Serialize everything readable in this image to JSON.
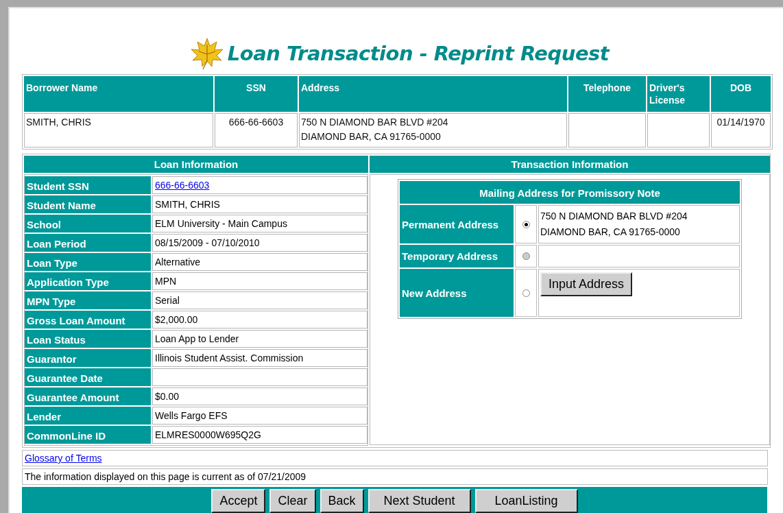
{
  "title": "Loan Transaction - Reprint Request",
  "borrower": {
    "columns": [
      "Borrower Name",
      "SSN",
      "Address",
      "Telephone",
      "Driver's License",
      "DOB"
    ],
    "row": {
      "name": "SMITH, CHRIS",
      "ssn": "666-66-6603",
      "address": [
        "750 N DIAMOND BAR BLVD #204",
        "DIAMOND BAR, CA 91765-0000"
      ],
      "dob": "01/14/1970"
    }
  },
  "loan_information": {
    "heading": "Loan Information",
    "rows": [
      {
        "label": "Student SSN",
        "value": "666-66-6603",
        "kind": "link"
      },
      {
        "label": "Student Name",
        "value": "SMITH, CHRIS",
        "kind": "text"
      },
      {
        "label": "School",
        "value": "ELM University - Main Campus",
        "kind": "text"
      },
      {
        "label": "Loan Period",
        "value": "08/15/2009 - 07/10/2010",
        "kind": "text"
      },
      {
        "label": "Loan Type",
        "value": "Alternative",
        "kind": "text"
      },
      {
        "label": "Application Type",
        "value": "MPN",
        "kind": "text"
      },
      {
        "label": "MPN Type",
        "value": "Serial",
        "kind": "text"
      },
      {
        "label": "Gross Loan Amount",
        "value": "$2,000.00",
        "kind": "text"
      },
      {
        "label": "Loan Status",
        "value": "Loan App to Lender",
        "kind": "text"
      },
      {
        "label": "Guarantor",
        "value": "Illinois Student Assist. Commission",
        "kind": "text"
      },
      {
        "label": "Guarantee Date",
        "kind": "text"
      },
      {
        "label": "Guarantee Amount",
        "value": "$0.00",
        "kind": "text"
      },
      {
        "label": "Lender",
        "value": "Wells Fargo EFS",
        "kind": "text"
      },
      {
        "label": "CommonLine ID",
        "value": "ELMRES0000W695Q2G",
        "kind": "text"
      }
    ]
  },
  "transaction_information": {
    "heading": "Transaction Information",
    "mailing": {
      "heading": "Mailing Address for Promissory Note",
      "options": [
        {
          "label": "Permanent Address",
          "selected": true,
          "disabled": false,
          "kind": "address",
          "address": [
            "750 N DIAMOND BAR BLVD #204",
            "DIAMOND BAR, CA 91765-0000"
          ]
        },
        {
          "label": "Temporary Address",
          "selected": false,
          "disabled": true,
          "kind": "address"
        },
        {
          "label": "New Address",
          "selected": false,
          "disabled": false,
          "kind": "button",
          "button": "Input Address"
        }
      ]
    }
  },
  "glossary_link": "Glossary of Terms",
  "currency_note": "The information displayed on this page is current as of 07/21/2009",
  "buttons": [
    "Accept",
    "Clear",
    "Back",
    "Next Student",
    "LoanListing"
  ]
}
